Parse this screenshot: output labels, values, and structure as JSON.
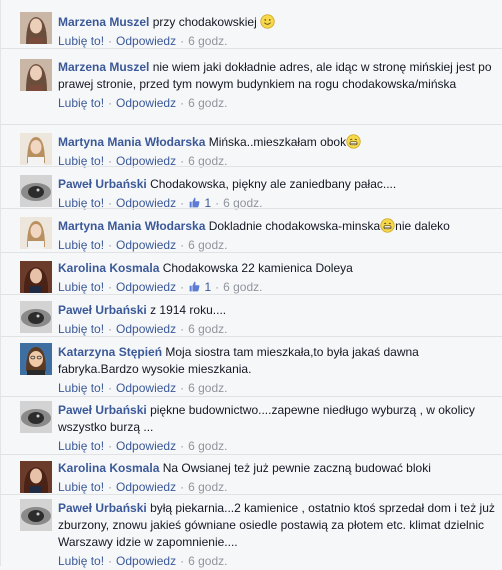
{
  "labels": {
    "like": "Lubię to!",
    "reply": "Odpowiedz",
    "separator": "·"
  },
  "comments": [
    {
      "author": "Marzena Muszel",
      "text": "przy chodakowskiej",
      "emoji": "smile",
      "time": "6 godz."
    },
    {
      "author": "Marzena Muszel",
      "text": "nie wiem jaki dokładnie adres, ale idąc w stronę mińskiej jest po prawej stronie, przed tym nowym budynkiem na rogu chodakowska/mińska",
      "time": "6 godz."
    },
    {
      "author": "Martyna Mania Włodarska",
      "text": "Mińska..mieszkałam obok",
      "emoji": "grin",
      "time": "6 godz."
    },
    {
      "author": "Paweł Urbański",
      "text": "Chodakowska, piękny ale zaniedbany pałac....",
      "likes": "1",
      "time": "6 godz."
    },
    {
      "author": "Martyna Mania Włodarska",
      "text": "Dokladnie chodakowska-minska",
      "emoji": "grin",
      "text_after": "nie daleko",
      "time": "6 godz."
    },
    {
      "author": "Karolina Kosmala",
      "text": "Chodakowska 22 kamienica Doleya",
      "likes": "1",
      "time": "6 godz."
    },
    {
      "author": "Paweł Urbański",
      "text": "z 1914 roku....",
      "time": "6 godz."
    },
    {
      "author": "Katarzyna Stępień",
      "text": "Moja siostra tam mieszkała,to była jakaś dawna fabryka.Bardzo wysokie mieszkania.",
      "time": "6 godz."
    },
    {
      "author": "Paweł Urbański",
      "text": "piękne budownictwo....zapewne niedługo wyburzą , w okolicy wszystko burzą ...",
      "time": "6 godz."
    },
    {
      "author": "Karolina Kosmala",
      "text": "Na Owsianej też już pewnie zaczną budować bloki",
      "time": "6 godz."
    },
    {
      "author": "Paweł Urbański",
      "text": "byłą piekarnia...2 kamienice , ostatnio ktoś sprzedał dom i też już zburzony, znowu jakieś gówniane osiedle postawią za płotem etc. klimat dzielnic Warszawy idzie w zapomnienie....",
      "time": "6 godz."
    }
  ]
}
